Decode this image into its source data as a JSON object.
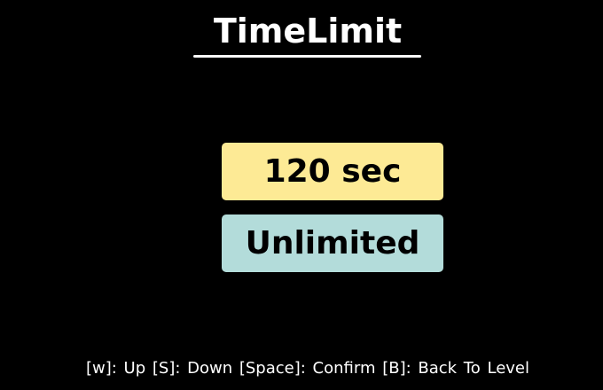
{
  "screen": {
    "title": "TimeLimit"
  },
  "options": [
    {
      "label": "120 sec",
      "color": "#fdea95",
      "selected": true
    },
    {
      "label": "Unlimited",
      "color": "#b3dcda",
      "selected": false
    }
  ],
  "controls_hint": "[w]: Up   [S]: Down   [Space]: Confirm   [B]: Back To Level",
  "colors": {
    "background": "#000000",
    "text": "#ffffff",
    "option_text": "#000000"
  }
}
